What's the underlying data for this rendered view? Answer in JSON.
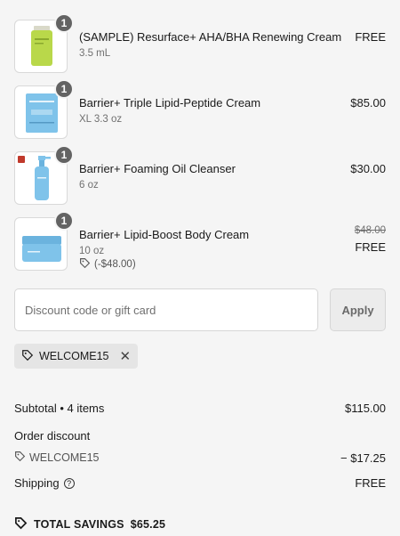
{
  "items": [
    {
      "quantity": "1",
      "name": "(SAMPLE) Resurface+ AHA/BHA Renewing Cream",
      "variant": "3.5 mL",
      "price": "FREE",
      "image": "green-sample-tube"
    },
    {
      "quantity": "1",
      "name": "Barrier+ Triple Lipid-Peptide Cream",
      "variant": "XL 3.3 oz",
      "price": "$85.00",
      "image": "blue-cream-box"
    },
    {
      "quantity": "1",
      "name": "Barrier+ Foaming Oil Cleanser",
      "variant": "6 oz",
      "price": "$30.00",
      "image": "blue-pump-bottle"
    },
    {
      "quantity": "1",
      "name": "Barrier+ Lipid-Boost Body Cream",
      "variant": "10 oz",
      "original_price": "$48.00",
      "price": "FREE",
      "discount_note": "(-$48.00)",
      "image": "blue-cream-jar"
    }
  ],
  "discount": {
    "placeholder": "Discount code or gift card",
    "value": "",
    "apply_label": "Apply"
  },
  "applied_code": {
    "code": "WELCOME15",
    "remove_icon": "close-icon"
  },
  "summary": {
    "subtotal_label": "Subtotal • 4 items",
    "subtotal_value": "$115.00",
    "order_discount_label": "Order discount",
    "order_discount_code": "WELCOME15",
    "order_discount_value": "− $17.25",
    "shipping_label": "Shipping",
    "shipping_value": "FREE",
    "total_savings_label": "TOTAL SAVINGS",
    "total_savings_value": "$65.25"
  },
  "colors": {
    "background": "#f5f5f5",
    "badge": "#636363",
    "chip": "#e5e5e5",
    "product_blue": "#7fc3ea",
    "sample_green": "#b9d84a"
  }
}
